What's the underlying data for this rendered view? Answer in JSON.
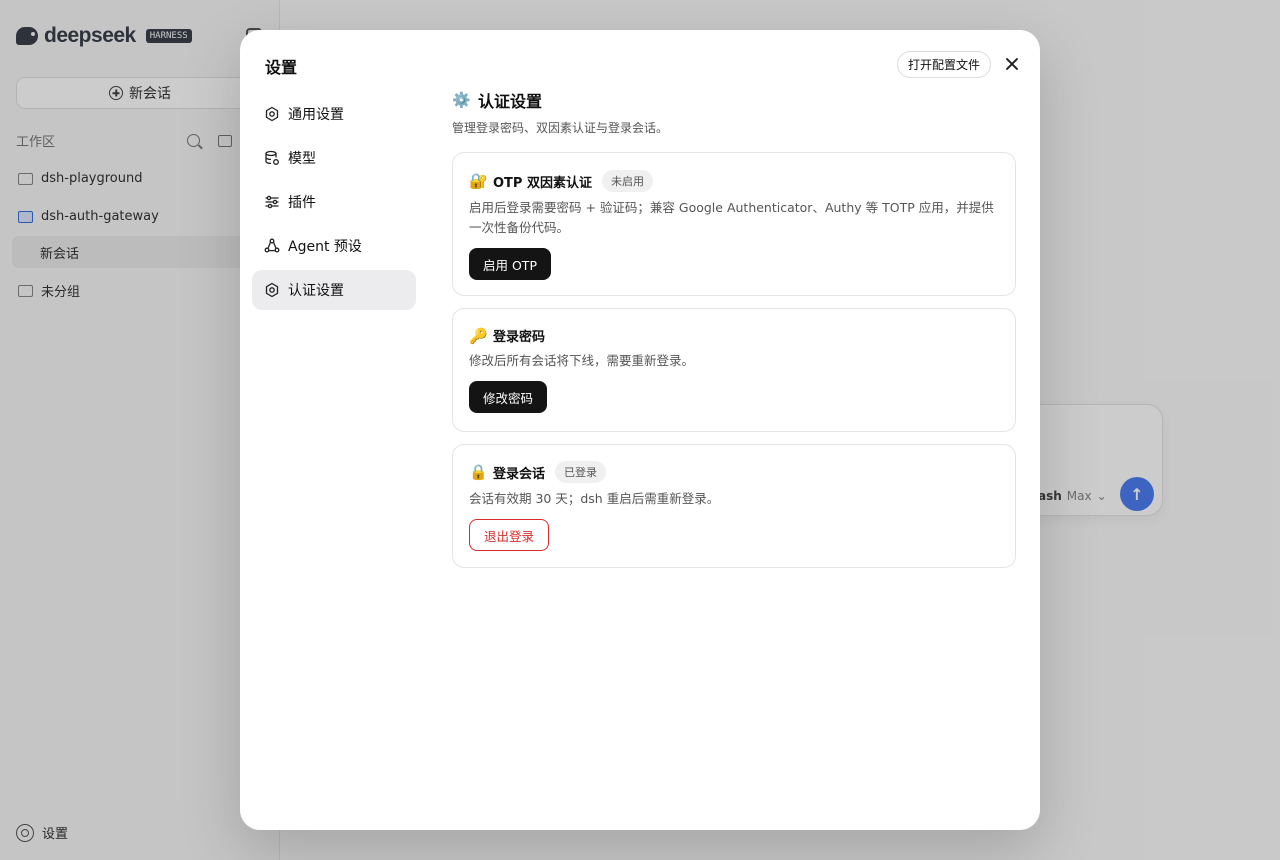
{
  "background": {
    "brand": {
      "name": "deepseek",
      "tag": "HARNESS"
    },
    "new_chat_label": "新会话",
    "workspace_label": "工作区",
    "folders": [
      "dsh-playground",
      "dsh-auth-gateway"
    ],
    "active_session": "新会话",
    "ungrouped_label": "未分组",
    "settings_label": "设置",
    "composer": {
      "model_prefix": "ash",
      "model_suffix": "Max",
      "send_icon": "arrow-up-icon"
    }
  },
  "modal": {
    "title": "设置",
    "open_config_label": "打开配置文件",
    "nav": [
      {
        "label": "通用设置",
        "icon": "gear-icon"
      },
      {
        "label": "模型",
        "icon": "database-icon"
      },
      {
        "label": "插件",
        "icon": "sliders-icon"
      },
      {
        "label": "Agent 预设",
        "icon": "agent-icon"
      },
      {
        "label": "认证设置",
        "icon": "gear-icon",
        "active": true
      }
    ],
    "section": {
      "emoji": "⚙️",
      "title": "认证设置",
      "subtitle": "管理登录密码、双因素认证与登录会话。"
    },
    "cards": {
      "otp": {
        "emoji": "🔐",
        "title": "OTP 双因素认证",
        "badge": "未启用",
        "desc": "启用后登录需要密码 + 验证码；兼容 Google Authenticator、Authy 等 TOTP 应用，并提供一次性备份代码。",
        "button": "启用 OTP"
      },
      "password": {
        "emoji": "🔑",
        "title": "登录密码",
        "desc": "修改后所有会话将下线，需要重新登录。",
        "button": "修改密码"
      },
      "session": {
        "emoji": "🔒",
        "title": "登录会话",
        "badge": "已登录",
        "desc": "会话有效期 30 天；dsh 重启后需重新登录。",
        "button": "退出登录"
      }
    }
  },
  "colors": {
    "danger": "#d92b2b",
    "primary_button": "#141414",
    "send_button": "#4c7df0"
  }
}
